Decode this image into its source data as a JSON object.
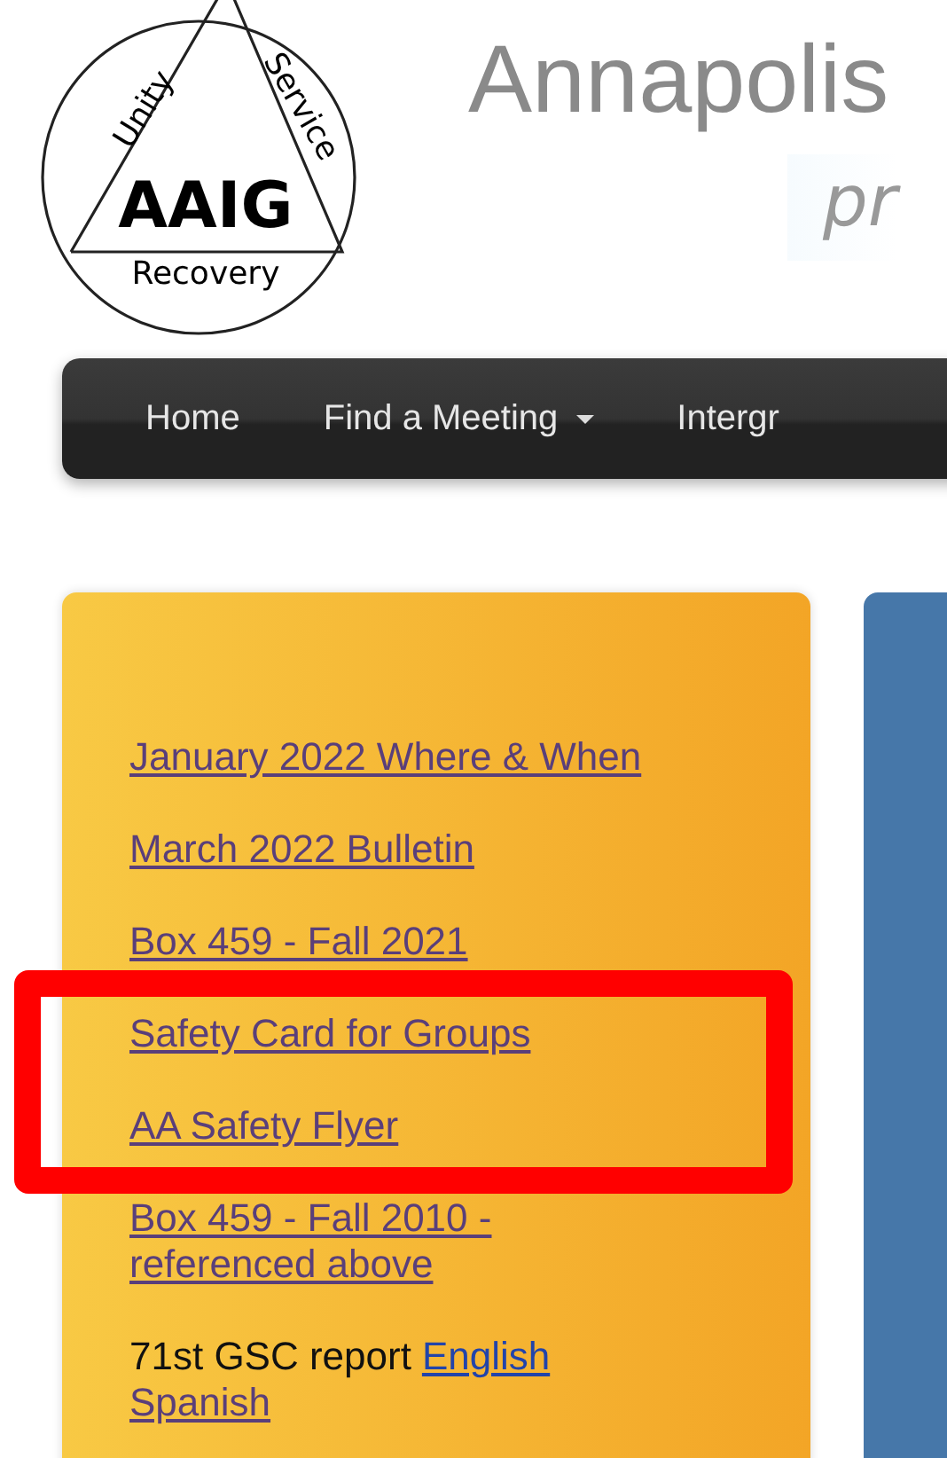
{
  "logo": {
    "top": "Unity",
    "right": "Service",
    "center": "AAIG",
    "bottom": "Recovery"
  },
  "header": {
    "title": "Annapolis",
    "tagline": "pr"
  },
  "nav": [
    {
      "label": "Home",
      "dropdown": false
    },
    {
      "label": "Find a Meeting",
      "dropdown": true
    },
    {
      "label": "Intergr",
      "dropdown": false
    }
  ],
  "sidebar": {
    "items": [
      {
        "kind": "link",
        "text": "January 2022 Where & When",
        "visited": true
      },
      {
        "kind": "link",
        "text": "March 2022 Bulletin",
        "visited": true
      },
      {
        "kind": "link",
        "text": "Box 459 - Fall 2021",
        "visited": true
      },
      {
        "kind": "link",
        "text": "Safety Card for Groups",
        "visited": true
      },
      {
        "kind": "link",
        "text": "AA Safety Flyer",
        "visited": true
      },
      {
        "kind": "link",
        "text": "Box 459 - Fall 2010 - referenced above",
        "visited": true
      },
      {
        "kind": "mixed",
        "text": "71st GSC report",
        "links": [
          {
            "text": "English",
            "visited": false
          },
          {
            "text": "Spanish",
            "visited": true
          }
        ]
      }
    ]
  },
  "annotation": {
    "kind": "highlight"
  }
}
